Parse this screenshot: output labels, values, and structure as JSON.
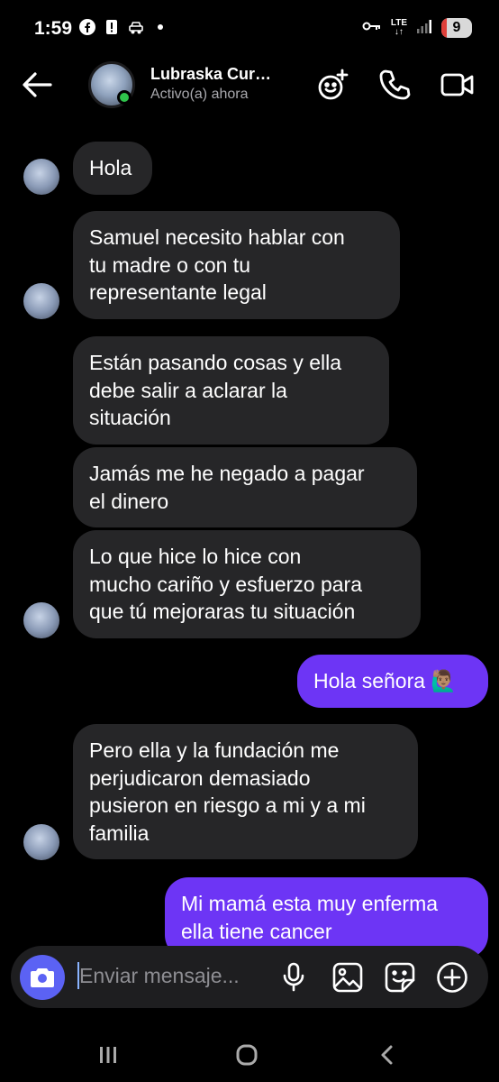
{
  "status_bar": {
    "time": "1:59",
    "network": "LTE",
    "battery": "9",
    "left_icons": [
      "facebook-icon",
      "alert-icon",
      "car-icon",
      "dot-icon"
    ],
    "right_icons": [
      "key-icon",
      "lte-icon",
      "signal-icon",
      "battery-icon"
    ]
  },
  "header": {
    "contact_name": "Lubraska Cur…",
    "status": "Activo(a) ahora",
    "actions": [
      "add-effects-icon",
      "phone-icon",
      "video-icon"
    ]
  },
  "messages": [
    {
      "direction": "incoming",
      "text_lines": [
        "Hola"
      ]
    },
    {
      "direction": "incoming",
      "text_lines": [
        "Samuel necesito hablar con",
        "tu madre o con tu",
        "representante legal"
      ]
    },
    {
      "direction": "incoming",
      "text_lines": [
        "Están pasando cosas y ella",
        "debe salir a aclarar la",
        "situación"
      ]
    },
    {
      "direction": "incoming",
      "text_lines": [
        "Jamás me he negado a pagar",
        "el dinero"
      ]
    },
    {
      "direction": "incoming",
      "text_lines": [
        "Lo que hice lo hice con",
        "mucho cariño y esfuerzo para",
        "que tú mejoraras tu situación"
      ]
    },
    {
      "direction": "outgoing",
      "text_lines": [
        "Hola señora 🙋🏽‍♂️"
      ]
    },
    {
      "direction": "incoming",
      "text_lines": [
        "Pero ella y la fundación me",
        "perjudicaron demasiado",
        "pusieron en riesgo a mi y a mi",
        "familia"
      ]
    },
    {
      "direction": "outgoing",
      "text_lines": [
        "Mi mamá esta muy enferma",
        "ella tiene cancer"
      ]
    }
  ],
  "composer": {
    "placeholder": "Enviar mensaje...",
    "buttons": [
      "camera-icon",
      "microphone-icon",
      "image-icon",
      "sticker-icon",
      "plus-icon"
    ]
  },
  "nav_bar": {
    "buttons": [
      "recent-apps-icon",
      "home-icon",
      "back-nav-icon"
    ]
  },
  "colors": {
    "background": "#000000",
    "incoming_bubble": "#262628",
    "outgoing_bubble": "#6d35f5",
    "camera_button": "#5b62f4",
    "online": "#2fc34c"
  }
}
